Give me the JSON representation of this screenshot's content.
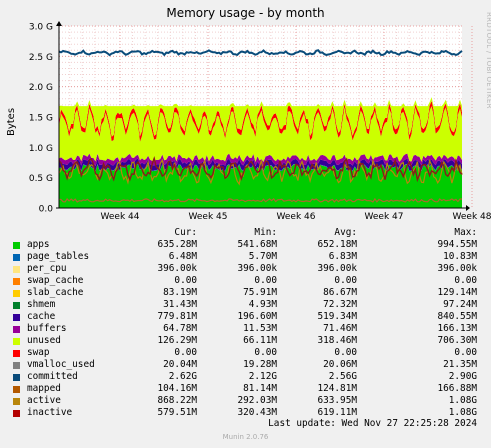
{
  "title": "Memory usage - by month",
  "side_label": "RRDTOOL / TOBI OETIKER",
  "chart_data": {
    "type": "area",
    "title": "Memory usage - by month",
    "ylabel": "Bytes",
    "ylim": [
      0,
      3.0
    ],
    "yticks": [
      "0.0",
      "0.5 G",
      "1.0 G",
      "1.5 G",
      "2.0 G",
      "2.5 G",
      "3.0 G"
    ],
    "xticks": [
      "Week 44",
      "Week 45",
      "Week 46",
      "Week 47",
      "Week 48"
    ],
    "grid": true,
    "stacked_series": [
      {
        "name": "apps",
        "color": "#00cc00",
        "avg": 0.652
      },
      {
        "name": "page_tables",
        "color": "#0066b3",
        "avg": 0.0068
      },
      {
        "name": "per_cpu",
        "color": "#ff8000",
        "avg": 0.0004
      },
      {
        "name": "swap_cache",
        "color": "#ffcc00",
        "avg": 0.0
      },
      {
        "name": "slab_cache",
        "color": "#330099",
        "avg": 0.0867
      },
      {
        "name": "shmem",
        "color": "#990099",
        "avg": 0.0723
      },
      {
        "name": "cache",
        "color": "#ccff00",
        "avg": 0.519
      },
      {
        "name": "buffers",
        "color": "#ff0000",
        "avg": 0.0715
      },
      {
        "name": "unused",
        "color": "#808080",
        "avg": 0.318
      }
    ],
    "line_series": [
      {
        "name": "committed",
        "color": "#0a4b7a",
        "avg": 2.56
      },
      {
        "name": "mapped",
        "color": "#a86a2c",
        "avg": 0.125
      },
      {
        "name": "active",
        "color": "#b8860b",
        "avg": 0.634
      },
      {
        "name": "inactive",
        "color": "#8b1a1a",
        "avg": 0.619
      }
    ]
  },
  "legend_header": {
    "cur": "Cur:",
    "min": "Min:",
    "avg": "Avg:",
    "max": "Max:"
  },
  "legend": [
    {
      "name": "apps",
      "color": "#00cc00",
      "cur": "635.28M",
      "min": "541.68M",
      "avg": "652.18M",
      "max": "994.55M"
    },
    {
      "name": "page_tables",
      "color": "#0066b3",
      "cur": "6.48M",
      "min": "5.70M",
      "avg": "6.83M",
      "max": "10.83M"
    },
    {
      "name": "per_cpu",
      "color": "#ffe680",
      "cur": "396.00k",
      "min": "396.00k",
      "avg": "396.00k",
      "max": "396.00k"
    },
    {
      "name": "swap_cache",
      "color": "#ff8000",
      "cur": "0.00",
      "min": "0.00",
      "avg": "0.00",
      "max": "0.00"
    },
    {
      "name": "slab_cache",
      "color": "#ffcc00",
      "cur": "83.19M",
      "min": "75.91M",
      "avg": "86.67M",
      "max": "129.14M"
    },
    {
      "name": "shmem",
      "color": "#00802b",
      "cur": "31.43M",
      "min": "4.93M",
      "avg": "72.32M",
      "max": "97.24M"
    },
    {
      "name": "cache",
      "color": "#330099",
      "cur": "779.81M",
      "min": "196.60M",
      "avg": "519.34M",
      "max": "840.55M"
    },
    {
      "name": "buffers",
      "color": "#990099",
      "cur": "64.78M",
      "min": "11.53M",
      "avg": "71.46M",
      "max": "166.13M"
    },
    {
      "name": "unused",
      "color": "#ccff00",
      "cur": "126.29M",
      "min": "66.11M",
      "avg": "318.46M",
      "max": "706.30M"
    },
    {
      "name": "swap",
      "color": "#ff0000",
      "cur": "0.00",
      "min": "0.00",
      "avg": "0.00",
      "max": "0.00"
    },
    {
      "name": "vmalloc_used",
      "color": "#808080",
      "cur": "20.04M",
      "min": "19.28M",
      "avg": "20.06M",
      "max": "21.35M"
    },
    {
      "name": "committed",
      "color": "#0a4b7a",
      "cur": "2.62G",
      "min": "2.12G",
      "avg": "2.56G",
      "max": "2.90G"
    },
    {
      "name": "mapped",
      "color": "#b35900",
      "cur": "104.16M",
      "min": "81.14M",
      "avg": "124.81M",
      "max": "166.88M"
    },
    {
      "name": "active",
      "color": "#b8860b",
      "cur": "868.22M",
      "min": "292.03M",
      "avg": "633.95M",
      "max": "1.08G"
    },
    {
      "name": "inactive",
      "color": "#b30000",
      "cur": "579.51M",
      "min": "320.43M",
      "avg": "619.11M",
      "max": "1.08G"
    }
  ],
  "last_update": "Last update: Wed Nov 27 22:25:28 2024",
  "version": "Munin 2.0.76"
}
